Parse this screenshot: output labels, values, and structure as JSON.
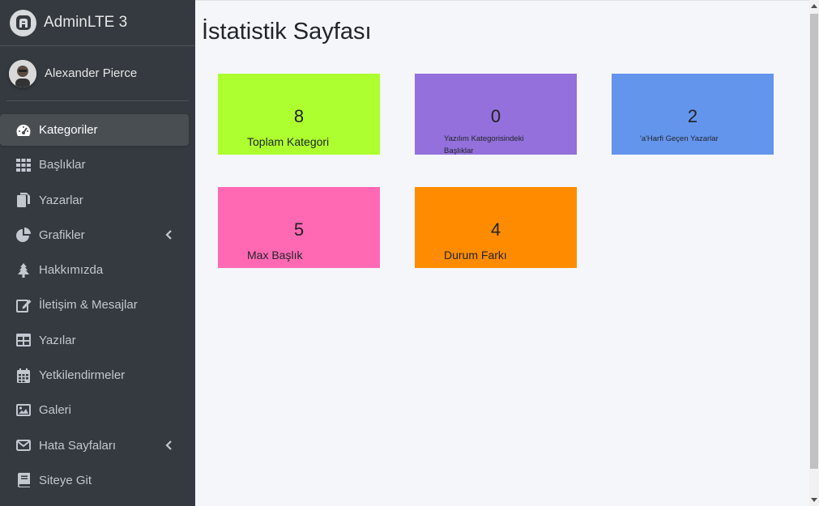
{
  "brand": {
    "title": "AdminLTE 3"
  },
  "user": {
    "name": "Alexander Pierce"
  },
  "sidebar": {
    "items": [
      {
        "label": "Kategoriler",
        "icon": "tachometer-icon"
      },
      {
        "label": "Başlıklar",
        "icon": "grid-icon"
      },
      {
        "label": "Yazarlar",
        "icon": "copy-icon"
      },
      {
        "label": "Grafikler",
        "icon": "pie-chart-icon"
      },
      {
        "label": "Hakkımızda",
        "icon": "tree-icon"
      },
      {
        "label": "İletişim & Mesajlar",
        "icon": "edit-icon"
      },
      {
        "label": "Yazılar",
        "icon": "table-icon"
      },
      {
        "label": "Yetkilendirmeler",
        "icon": "calendar-icon"
      },
      {
        "label": "Galeri",
        "icon": "image-icon"
      },
      {
        "label": "Hata Sayfaları",
        "icon": "envelope-icon"
      },
      {
        "label": "Siteye Git",
        "icon": "book-icon"
      }
    ]
  },
  "main": {
    "title": "İstatistik Sayfası",
    "cards": [
      {
        "value": "8",
        "label": "Toplam Kategori",
        "color": "#adff2f"
      },
      {
        "value": "0",
        "label": "Yazılım Kategorisindeki Başlıklar",
        "color": "#9370db"
      },
      {
        "value": "2",
        "label": "'a'Harfi Geçen Yazarlar",
        "color": "#6495ed"
      },
      {
        "value": "5",
        "label": "Max Başlık",
        "color": "#ff69b4"
      },
      {
        "value": "4",
        "label": "Durum Farkı",
        "color": "#ff8c00"
      }
    ]
  }
}
